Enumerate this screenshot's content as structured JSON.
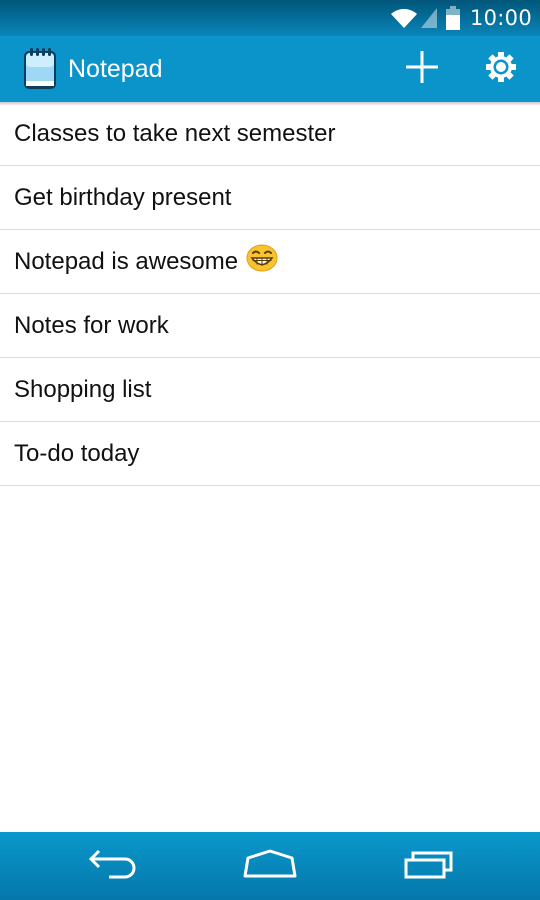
{
  "status_bar": {
    "time": "10:00",
    "icons": [
      "wifi-icon",
      "cell-signal-icon",
      "battery-icon"
    ]
  },
  "action_bar": {
    "title": "Notepad",
    "app_icon": "notepad-icon",
    "actions": [
      {
        "name": "add-note-button",
        "icon": "plus-icon"
      },
      {
        "name": "settings-button",
        "icon": "gear-icon"
      }
    ]
  },
  "notes": [
    {
      "title": "Classes to take next semester"
    },
    {
      "title": "Get birthday present"
    },
    {
      "title": "Notepad is awesome",
      "emoji": "grinning-face-icon"
    },
    {
      "title": "Notes for work"
    },
    {
      "title": "Shopping list"
    },
    {
      "title": "To-do today"
    }
  ],
  "nav_bar": {
    "buttons": [
      "back-icon",
      "home-icon",
      "recents-icon"
    ]
  },
  "colors": {
    "status_bar": "#0a85b8",
    "action_bar": "#0a94c9",
    "nav_bar": "#0a98cc",
    "divider": "#dcdcdc",
    "text": "#111111"
  }
}
